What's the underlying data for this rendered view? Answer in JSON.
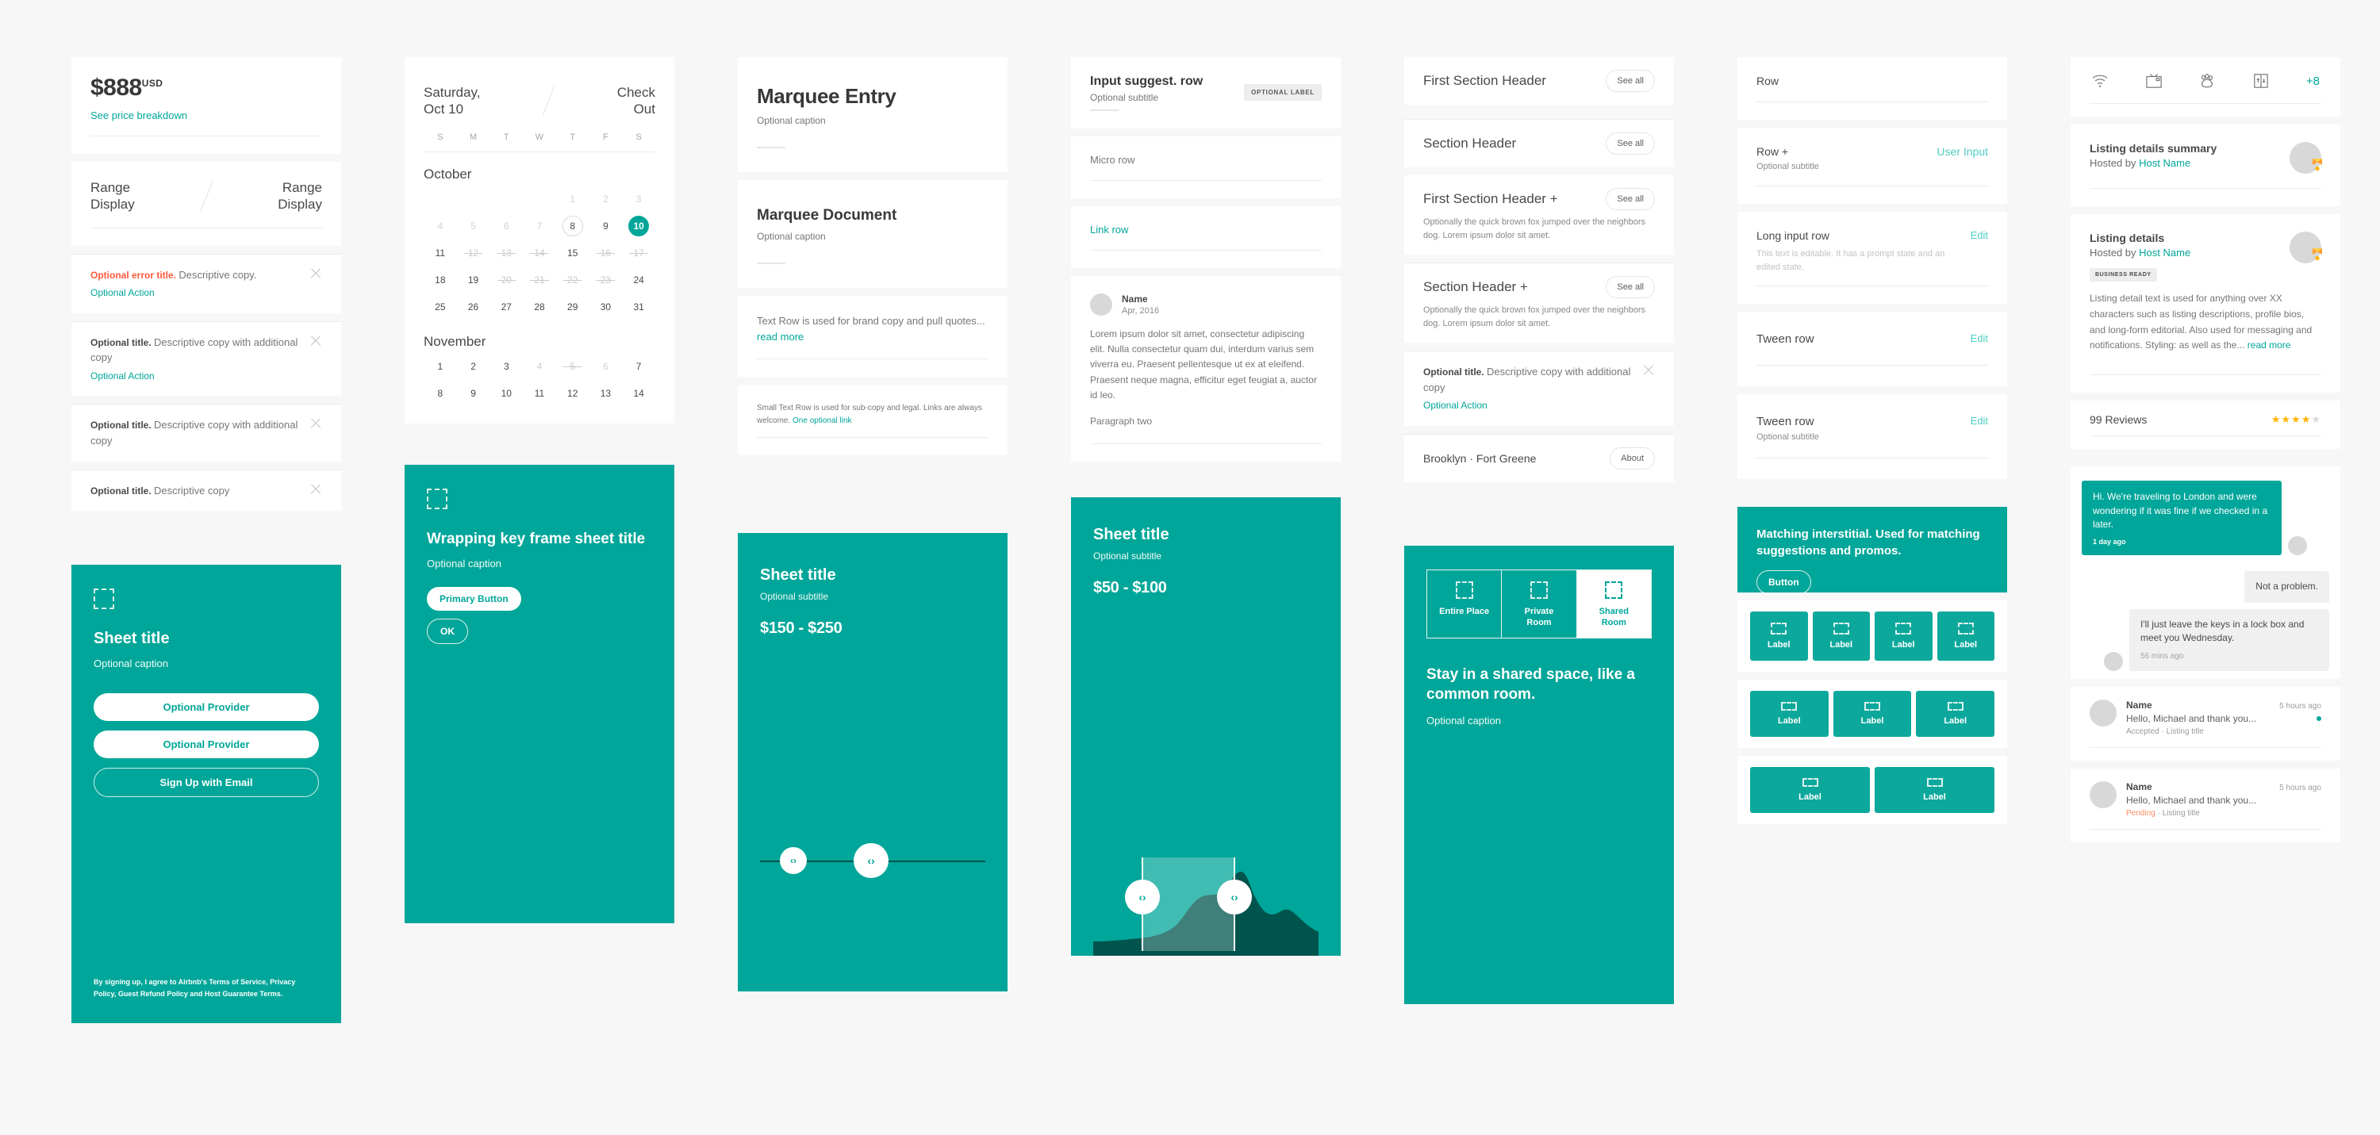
{
  "colors": {
    "teal": "#00a699",
    "tealLight": "#4ecdc4",
    "error": "#ff5a3d",
    "star": "#ffb400",
    "pending": "#ff8a65"
  },
  "price_card": {
    "amount": "$888",
    "currency": "USD",
    "breakdown_link": "See price breakdown"
  },
  "range_card": {
    "left_line1": "Range",
    "left_line2": "Display",
    "right_line1": "Range",
    "right_line2": "Display"
  },
  "alerts": [
    {
      "title": "Optional error title.",
      "body": "Descriptive copy.",
      "action": "Optional Action",
      "error": true
    },
    {
      "title": "Optional title.",
      "body": "Descriptive copy with additional copy",
      "action": "Optional Action",
      "error": false
    },
    {
      "title": "Optional title.",
      "body": "Descriptive copy with additional copy",
      "action": "",
      "error": false
    },
    {
      "title": "Optional title.",
      "body": "Descriptive copy",
      "action": "",
      "error": false
    }
  ],
  "calendar": {
    "checkin_line1": "Saturday,",
    "checkin_line2": "Oct 10",
    "checkout_line1": "Check",
    "checkout_line2": "Out",
    "dow": [
      "S",
      "M",
      "T",
      "W",
      "T",
      "F",
      "S"
    ],
    "months": [
      {
        "name": "October",
        "leading_blanks": 4,
        "days": [
          {
            "n": "1",
            "state": "off"
          },
          {
            "n": "2",
            "state": "off"
          },
          {
            "n": "3",
            "state": "off"
          },
          {
            "n": "4",
            "state": "off"
          },
          {
            "n": "5",
            "state": "off"
          },
          {
            "n": "6",
            "state": "off"
          },
          {
            "n": "7",
            "state": "off"
          },
          {
            "n": "8",
            "state": "today"
          },
          {
            "n": "9",
            "state": "on"
          },
          {
            "n": "10",
            "state": "sel"
          },
          {
            "n": "11",
            "state": "on"
          },
          {
            "n": "12",
            "state": "strike"
          },
          {
            "n": "13",
            "state": "strike"
          },
          {
            "n": "14",
            "state": "strike"
          },
          {
            "n": "15",
            "state": "on"
          },
          {
            "n": "16",
            "state": "strike"
          },
          {
            "n": "17",
            "state": "strike"
          },
          {
            "n": "18",
            "state": "on"
          },
          {
            "n": "19",
            "state": "on"
          },
          {
            "n": "20",
            "state": "strike"
          },
          {
            "n": "21",
            "state": "strike"
          },
          {
            "n": "22",
            "state": "strike"
          },
          {
            "n": "23",
            "state": "strike"
          },
          {
            "n": "24",
            "state": "on"
          },
          {
            "n": "25",
            "state": "on"
          },
          {
            "n": "26",
            "state": "on"
          },
          {
            "n": "27",
            "state": "on"
          },
          {
            "n": "28",
            "state": "on"
          },
          {
            "n": "29",
            "state": "on"
          },
          {
            "n": "30",
            "state": "on"
          },
          {
            "n": "31",
            "state": "on"
          }
        ]
      },
      {
        "name": "November",
        "leading_blanks": 0,
        "days": [
          {
            "n": "1",
            "state": "on"
          },
          {
            "n": "2",
            "state": "on"
          },
          {
            "n": "3",
            "state": "on"
          },
          {
            "n": "4",
            "state": "off"
          },
          {
            "n": "5",
            "state": "strike"
          },
          {
            "n": "6",
            "state": "off"
          },
          {
            "n": "7",
            "state": "on"
          },
          {
            "n": "8",
            "state": "on"
          },
          {
            "n": "9",
            "state": "on"
          },
          {
            "n": "10",
            "state": "on"
          },
          {
            "n": "11",
            "state": "on"
          },
          {
            "n": "12",
            "state": "on"
          },
          {
            "n": "13",
            "state": "on"
          },
          {
            "n": "14",
            "state": "on"
          }
        ]
      }
    ]
  },
  "marquee": {
    "entry_title": "Marquee Entry",
    "entry_caption": "Optional caption",
    "doc_title": "Marquee Document",
    "doc_caption": "Optional caption",
    "text_row": "Text Row is used for brand copy and pull quotes...",
    "text_row_link": "read more",
    "small_text_row": "Small Text Row is used for sub-copy and legal. Links are always welcome.",
    "small_text_row_link": "One optional link"
  },
  "suggest": {
    "title": "Input suggest. row",
    "subtitle": "Optional subtitle",
    "label": "OPTIONAL LABEL",
    "micro_row": "Micro row",
    "link_row": "Link row"
  },
  "review": {
    "name": "Name",
    "date": "Apr, 2016",
    "body": "Lorem ipsum dolor sit amet, consectetur adipiscing elit. Nulla consectetur quam dui, interdum varius sem viverra eu. Praesent pellentesque ut ex at eleifend. Praesent neque magna, efficitur eget feugiat a, auctor id leo.",
    "paragraph_two": "Paragraph two"
  },
  "sections": {
    "see_all": "See all",
    "about": "About",
    "first_header": "First Section Header",
    "header": "Section Header",
    "first_header_plus": "First Section Header +",
    "header_plus": "Section Header +",
    "desc": "Optionally the quick brown fox jumped over the neighbors dog. Lorem ipsum dolor sit amet.",
    "alert_title": "Optional title.",
    "alert_body": "Descriptive copy with additional copy",
    "alert_action": "Optional Action",
    "location": "Brooklyn  ·  Fort Greene"
  },
  "input_rows": {
    "row": "Row",
    "row_plus": "Row +",
    "row_plus_sub": "Optional subtitle",
    "user_input": "User Input",
    "long_row": "Long input row",
    "long_row_prompt": "This text is editable. It has a prompt state and an edited state.",
    "edit": "Edit",
    "tween_row_1": "Tween row",
    "tween_row_2": "Tween row",
    "tween_sub": "Optional subtitle"
  },
  "listing": {
    "amenities": [
      "wifi-icon",
      "tv-icon",
      "pets-icon",
      "elevator-icon"
    ],
    "amenities_more": "+8",
    "summary_title": "Listing details summary",
    "hosted_by": "Hosted by",
    "host_name": "Host Name",
    "details_title": "Listing details",
    "business_tag": "BUSINESS READY",
    "detail_text": "Listing detail text is used for anything over XX characters such as listing descriptions, profile bios, and long-form editorial. Also used for messaging and notifications. Styling: as well as the...",
    "detail_link": "read more",
    "reviews_count": "99 Reviews",
    "rating": 4,
    "rating_max": 5
  },
  "sheet_signup": {
    "title": "Sheet title",
    "caption": "Optional caption",
    "provider_1": "Optional Provider",
    "provider_2": "Optional Provider",
    "email_btn": "Sign Up with Email",
    "legal": "By signing up, I agree to Airbnb's Terms of Service, Privacy Policy, Guest Refund Policy and Host Guarantee Terms."
  },
  "sheet_keyframe": {
    "title": "Wrapping key frame sheet title",
    "caption": "Optional caption",
    "primary_btn": "Primary Button",
    "ok_btn": "OK"
  },
  "sheet_price_1": {
    "title": "Sheet title",
    "subtitle": "Optional subtitle",
    "price": "$150 - $250",
    "handle_left": "‹›",
    "handle_right": "‹›"
  },
  "sheet_price_2": {
    "title": "Sheet title",
    "subtitle": "Optional subtitle",
    "price": "$50 - $100",
    "handle_left": "‹›",
    "handle_right": "‹›"
  },
  "room_selector": {
    "options": [
      {
        "label_1": "Entire Place",
        "label_2": "",
        "active": false
      },
      {
        "label_1": "Private",
        "label_2": "Room",
        "active": false
      },
      {
        "label_1": "Shared",
        "label_2": "Room",
        "active": true
      }
    ],
    "headline": "Stay in a shared space, like a common room.",
    "caption": "Optional caption"
  },
  "interstitial": {
    "text": "Matching interstitial. Used for matching suggestions and promos.",
    "button": "Button"
  },
  "tile_rows": [
    {
      "count": 4,
      "label": "Label"
    },
    {
      "count": 3,
      "label": "Label"
    },
    {
      "count": 2,
      "label": "Label"
    }
  ],
  "chat": {
    "outgoing": {
      "text": "Hi. We're traveling to London and were wondering if it was fine if we checked in a later.",
      "time": "1 day ago"
    },
    "incoming_1": {
      "text": "Not a problem."
    },
    "incoming_2": {
      "text": "I'll just leave the keys in a lock box and meet you Wednesday.",
      "time": "56 mins ago"
    }
  },
  "threads": [
    {
      "name": "Name",
      "time": "5 hours ago",
      "preview": "Hello, Michael and thank you...",
      "status": "Accepted",
      "listing": "Listing title",
      "unread": true,
      "pending": false
    },
    {
      "name": "Name",
      "time": "5 hours ago",
      "preview": "Hello, Michael and thank you...",
      "status": "Pending",
      "listing": "Listing title",
      "unread": false,
      "pending": true
    }
  ]
}
